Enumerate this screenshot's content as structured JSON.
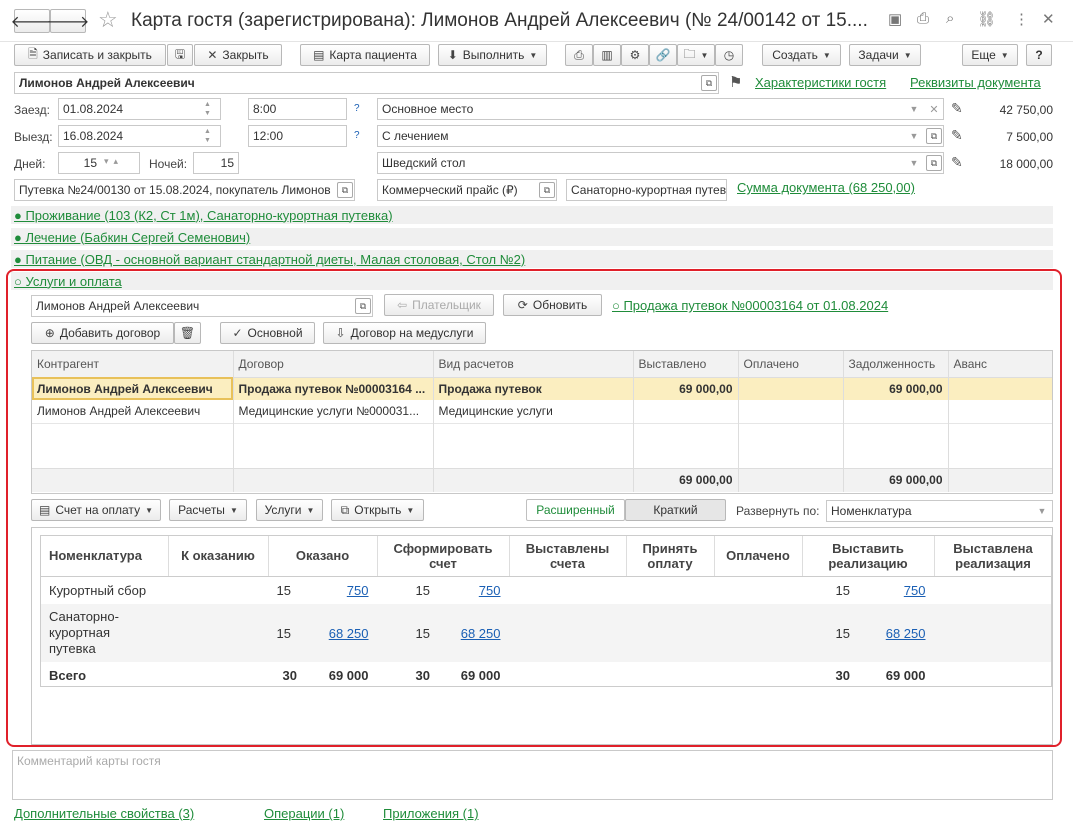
{
  "window": {
    "title": "Карта гостя (зарегистрирована): Лимонов Андрей Алексеевич (№ 24/00142 от 15...."
  },
  "toolbar": {
    "save_close": "Записать и закрыть",
    "close": "Закрыть",
    "patient_card": "Карта пациента",
    "execute": "Выполнить",
    "create": "Создать",
    "tasks": "Задачи",
    "more": "Еще",
    "help": "?"
  },
  "guest": {
    "name": "Лимонов Андрей Алексеевич",
    "link_characteristics": "Характеристики гостя",
    "link_requisites": "Реквизиты документа"
  },
  "stay": {
    "arrival_label": "Заезд:",
    "arrival_date": "01.08.2024",
    "arrival_time": "8:00",
    "departure_label": "Выезд:",
    "departure_date": "16.08.2024",
    "departure_time": "12:00",
    "days_label": "Дней:",
    "days": "15",
    "nights_label": "Ночей:",
    "nights": "15",
    "q": "?"
  },
  "options": [
    {
      "value": "Основное место",
      "amount": "42 750,00"
    },
    {
      "value": "С лечением",
      "amount": "7 500,00"
    },
    {
      "value": "Шведский стол",
      "amount": "18 000,00"
    }
  ],
  "voucher": {
    "text": "Путевка №24/00130 от 15.08.2024, покупатель Лимонов",
    "price_list": "Коммерческий прайс (₽)",
    "voucher_type": "Санаторно-курортная путев",
    "sum_link": "Сумма документа (68 250,00)"
  },
  "groups": {
    "living": "● Проживание (103 (К2, Ст 1м), Санаторно-курортная путевка)",
    "treatment": "● Лечение (Бабкин Сергей Семенович)",
    "food": "● Питание (ОВД - основной вариант стандартной диеты, Малая столовая, Стол №2)",
    "services": "○ Услуги и оплата"
  },
  "payment": {
    "payer": "Лимонов Андрей Алексеевич",
    "payer_btn": "Плательщик",
    "refresh_btn": "Обновить",
    "sale_link": "○ Продажа путевок №00003164 от 01.08.2024",
    "add_contract": "Добавить договор",
    "main_btn": "Основной",
    "med_contract": "Договор на медуслуги"
  },
  "contracts": {
    "columns": [
      "Контрагент",
      "Договор",
      "Вид расчетов",
      "Выставлено",
      "Оплачено",
      "Задолженность",
      "Аванс"
    ],
    "rows": [
      [
        "Лимонов Андрей Алексеевич",
        "Продажа путевок №00003164 ...",
        "Продажа путевок",
        "69 000,00",
        "",
        "69 000,00",
        ""
      ],
      [
        "Лимонов Андрей Алексеевич",
        "Медицинские услуги №000031...",
        "Медицинские услуги",
        "",
        "",
        "",
        ""
      ]
    ],
    "totals": [
      "",
      "",
      "",
      "69 000,00",
      "",
      "69 000,00",
      ""
    ]
  },
  "lower_toolbar": {
    "invoice": "Счет на оплату",
    "calculations": "Расчеты",
    "services": "Услуги",
    "open": "Открыть",
    "extended": "Расширенный",
    "brief": "Краткий",
    "expand_label": "Развернуть по:",
    "expand_value": "Номенклатура"
  },
  "report": {
    "columns": [
      "Номенклатура",
      "К оказанию",
      "Оказано",
      "Сформировать счет",
      "Выставлены счета",
      "Принять оплату",
      "Оплачено",
      "Выставить реализацию",
      "Выставлена реализация"
    ],
    "rows": [
      {
        "name": "Курортный сбор",
        "provided_qty": "15",
        "provided_sum": "750",
        "form_qty": "15",
        "form_sum": "750",
        "real_qty": "15",
        "real_sum": "750"
      },
      {
        "name": "Санаторно-курортная путевка",
        "provided_qty": "15",
        "provided_sum": "68 250",
        "form_qty": "15",
        "form_sum": "68 250",
        "real_qty": "15",
        "real_sum": "68 250"
      }
    ],
    "total": {
      "name": "Всего",
      "provided_qty": "30",
      "provided_sum": "69 000",
      "form_qty": "30",
      "form_sum": "69 000",
      "real_qty": "30",
      "real_sum": "69 000"
    }
  },
  "comment_placeholder": "Комментарий карты гостя",
  "footer": {
    "extra": "Дополнительные свойства (3)",
    "operations": "Операции (1)",
    "attachments": "Приложения (1)"
  },
  "colors": {
    "accent_green": "#1f8c3a",
    "highlight_row": "#fbeec0",
    "red_frame": "#e0202a"
  }
}
